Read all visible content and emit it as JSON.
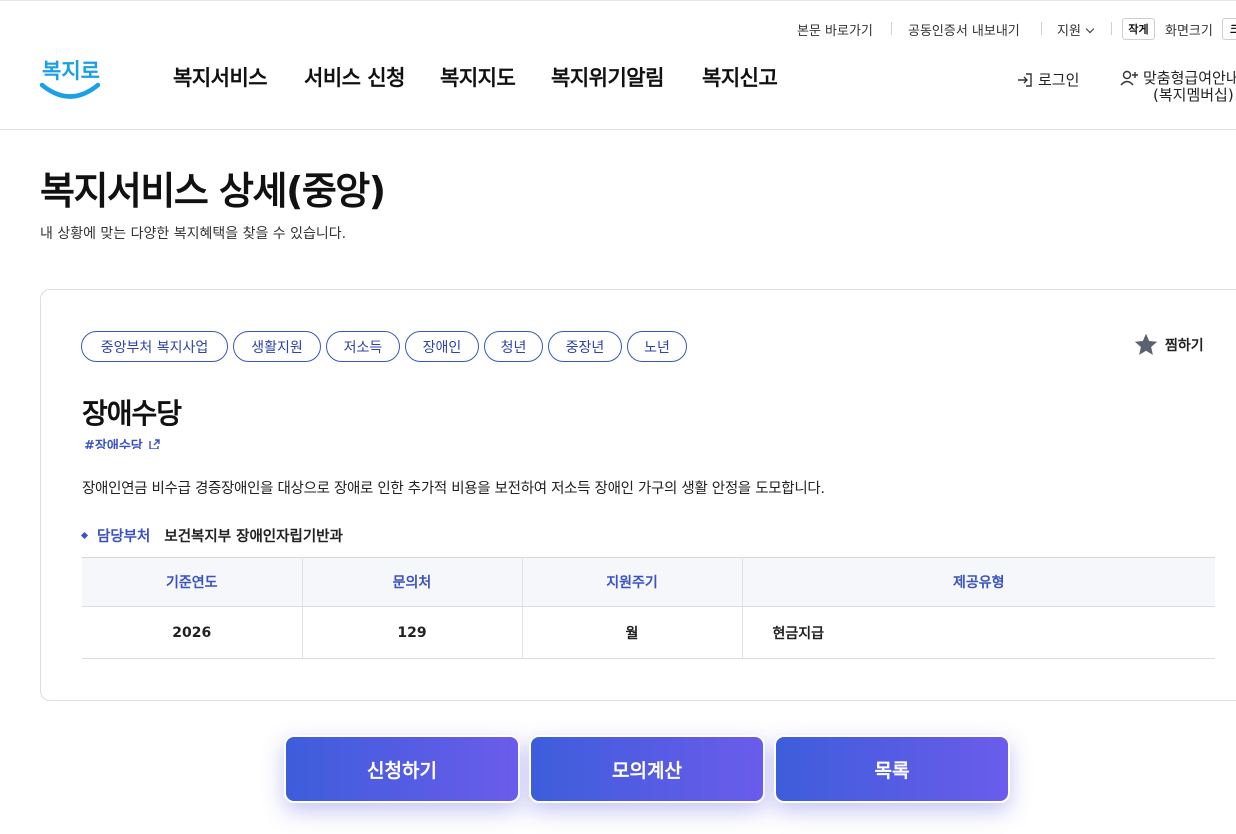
{
  "utility": {
    "skip_to_content": "본문 바로가기",
    "cert_export": "공동인증서 내보내기",
    "support": "지원",
    "font_small": "작게",
    "screen_size_label": "화면크기",
    "font_large_partial": "크"
  },
  "header": {
    "logo_text": "복지로",
    "nav": [
      "복지서비스",
      "서비스 신청",
      "복지지도",
      "복지위기알림",
      "복지신고"
    ],
    "login": "로그인",
    "membership_line1": "맞춤형급여안내",
    "membership_line2": "(복지멤버십)"
  },
  "page": {
    "title": "복지서비스 상세(중앙)",
    "description": "내 상황에 맞는 다양한 복지혜택을 찾을 수 있습니다."
  },
  "service": {
    "tags": [
      "중앙부처 복지사업",
      "생활지원",
      "저소득",
      "장애인",
      "청년",
      "중장년",
      "노년"
    ],
    "favorite_label": "찜하기",
    "title": "장애수당",
    "hashtag": "#장애수당",
    "description": "장애인연금 비수급 경증장애인을 대상으로 장애로 인한 추가적 비용을 보전하여 저소득 장애인 가구의 생활 안정을 도모합니다.",
    "dept_label": "담당부처",
    "dept_value": "보건복지부 장애인자립기반과",
    "table": {
      "headers": [
        "기준연도",
        "문의처",
        "지원주기",
        "제공유형"
      ],
      "row": [
        "2026",
        "129",
        "월",
        "현금지급"
      ]
    }
  },
  "actions": {
    "apply": "신청하기",
    "simulate": "모의계산",
    "list": "목록"
  },
  "colors": {
    "accent": "#3b53c2",
    "button_start": "#3d5ddb",
    "button_end": "#6b5cec",
    "logo_blue": "#1aa0e6"
  }
}
